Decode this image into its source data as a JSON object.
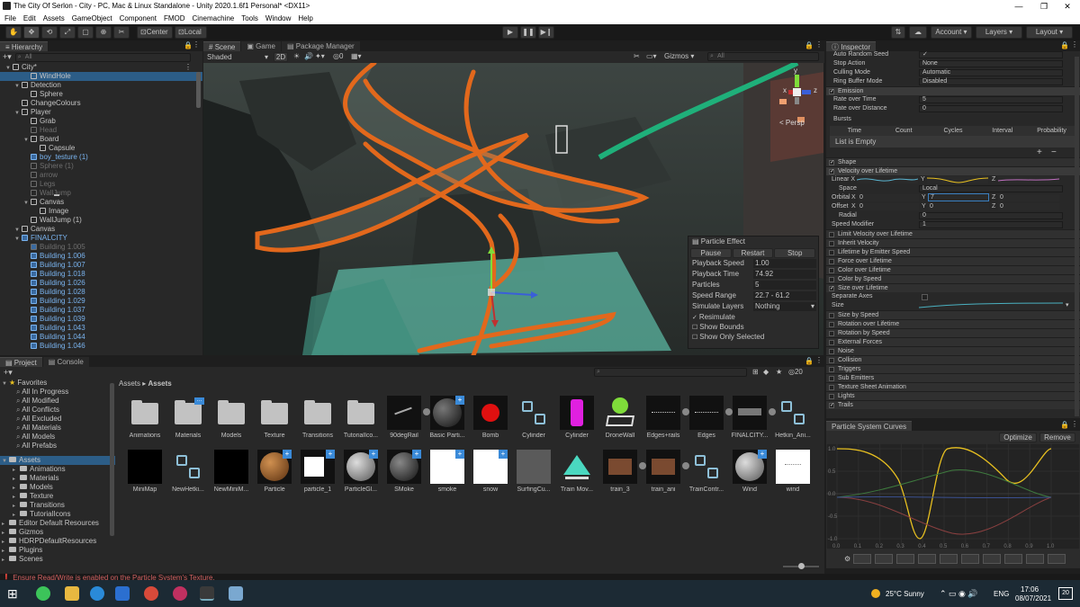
{
  "window": {
    "title": "The City Of Serlon - City - PC, Mac & Linux Standalone - Unity 2020.1.6f1 Personal* <DX11>"
  },
  "menu": [
    "File",
    "Edit",
    "Assets",
    "GameObject",
    "Component",
    "FMOD",
    "Cinemachine",
    "Tools",
    "Window",
    "Help"
  ],
  "toolbar": {
    "pivot": "Center",
    "space": "Local",
    "account": "Account",
    "layers": "Layers",
    "layout": "Layout"
  },
  "hierarchy": {
    "tab": "Hierarchy",
    "search_placeholder": "All",
    "rows": [
      {
        "label": "City*",
        "depth": 0,
        "kind": "scene",
        "sel": false
      },
      {
        "label": "WindHole",
        "depth": 2,
        "kind": "go",
        "sel": true
      },
      {
        "label": "Detection",
        "depth": 1,
        "kind": "go",
        "sel": false
      },
      {
        "label": "Sphere",
        "depth": 2,
        "kind": "go",
        "sel": false
      },
      {
        "label": "ChangeColours",
        "depth": 1,
        "kind": "go",
        "sel": false
      },
      {
        "label": "Player",
        "depth": 1,
        "kind": "go",
        "sel": false
      },
      {
        "label": "Grab",
        "depth": 2,
        "kind": "go",
        "sel": false
      },
      {
        "label": "Head",
        "depth": 2,
        "kind": "dim",
        "sel": false
      },
      {
        "label": "Board",
        "depth": 2,
        "kind": "go",
        "sel": false
      },
      {
        "label": "Capsule",
        "depth": 3,
        "kind": "go",
        "sel": false
      },
      {
        "label": "boy_testure (1)",
        "depth": 2,
        "kind": "prefab",
        "sel": false
      },
      {
        "label": "Sphere (1)",
        "depth": 2,
        "kind": "dim",
        "sel": false
      },
      {
        "label": "arrow",
        "depth": 2,
        "kind": "dim",
        "sel": false
      },
      {
        "label": "Legs",
        "depth": 2,
        "kind": "dim",
        "sel": false
      },
      {
        "label": "WallJump",
        "depth": 2,
        "kind": "dim",
        "sel": false
      },
      {
        "label": "Canvas",
        "depth": 2,
        "kind": "go",
        "sel": false
      },
      {
        "label": "Image",
        "depth": 3,
        "kind": "go",
        "sel": false
      },
      {
        "label": "WallJump (1)",
        "depth": 2,
        "kind": "go",
        "sel": false
      },
      {
        "label": "Canvas",
        "depth": 1,
        "kind": "go",
        "sel": false
      },
      {
        "label": "FINALCITY",
        "depth": 1,
        "kind": "prefab",
        "sel": false
      },
      {
        "label": "Building 1.005",
        "depth": 2,
        "kind": "dimprefab",
        "sel": false
      },
      {
        "label": "Building 1.006",
        "depth": 2,
        "kind": "prefab",
        "sel": false
      },
      {
        "label": "Building 1.007",
        "depth": 2,
        "kind": "prefab",
        "sel": false
      },
      {
        "label": "Building 1.018",
        "depth": 2,
        "kind": "prefab",
        "sel": false
      },
      {
        "label": "Building 1.026",
        "depth": 2,
        "kind": "prefab",
        "sel": false
      },
      {
        "label": "Building 1.028",
        "depth": 2,
        "kind": "prefab",
        "sel": false
      },
      {
        "label": "Building 1.029",
        "depth": 2,
        "kind": "prefab",
        "sel": false
      },
      {
        "label": "Building 1.037",
        "depth": 2,
        "kind": "prefab",
        "sel": false
      },
      {
        "label": "Building 1.039",
        "depth": 2,
        "kind": "prefab",
        "sel": false
      },
      {
        "label": "Building 1.043",
        "depth": 2,
        "kind": "prefab",
        "sel": false
      },
      {
        "label": "Building 1.044",
        "depth": 2,
        "kind": "prefab",
        "sel": false
      },
      {
        "label": "Building 1.046",
        "depth": 2,
        "kind": "prefab",
        "sel": false
      }
    ]
  },
  "scene": {
    "tabs": [
      "Scene",
      "Game",
      "Package Manager"
    ],
    "shading": "Shaded",
    "mode_2d": "2D",
    "gizmos": "Gizmos",
    "search_placeholder": "All",
    "persp": "< Persp",
    "axes": {
      "y": "y",
      "x": "x",
      "z": "z"
    },
    "overlay": {
      "title": "Particle Effect",
      "buttons": [
        "Pause",
        "Restart",
        "Stop"
      ],
      "rows": [
        {
          "label": "Playback Speed",
          "value": "1.00"
        },
        {
          "label": "Playback Time",
          "value": "74.92"
        },
        {
          "label": "Particles",
          "value": "5"
        },
        {
          "label": "Speed Range",
          "value": "22.7 - 61.2"
        },
        {
          "label": "Simulate Layers",
          "value": "Nothing"
        }
      ],
      "checks": [
        {
          "label": "Resimulate",
          "on": true
        },
        {
          "label": "Show Bounds",
          "on": false
        },
        {
          "label": "Show Only Selected",
          "on": false
        }
      ]
    }
  },
  "inspector": {
    "tab": "Inspector",
    "top_rows": [
      {
        "label": "Auto Random Seed",
        "value": "✓"
      },
      {
        "label": "Stop Action",
        "value": "None"
      },
      {
        "label": "Culling Mode",
        "value": "Automatic"
      },
      {
        "label": "Ring Buffer Mode",
        "value": "Disabled"
      }
    ],
    "emission": {
      "header": "Emission",
      "rows": [
        {
          "label": "Rate over Time",
          "value": "5"
        },
        {
          "label": "Rate over Distance",
          "value": "0"
        }
      ],
      "bursts": "Bursts",
      "burst_cols": [
        "Time",
        "Count",
        "Cycles",
        "Interval",
        "Probability"
      ],
      "empty": "List is Empty"
    },
    "shape": "Shape",
    "velocity": {
      "header": "Velocity over Lifetime",
      "linear": "Linear",
      "space_label": "Space",
      "space_value": "Local",
      "orbital_label": "Orbital",
      "orbital_x": "0",
      "orbital_y": "7",
      "orbital_z": "0",
      "offset_label": "Offset",
      "offset_x": "0",
      "offset_y": "0",
      "offset_z": "0",
      "radial_label": "Radial",
      "radial_value": "0",
      "speedmod_label": "Speed Modifier",
      "speedmod_value": "1"
    },
    "modules_a": [
      {
        "label": "Limit Velocity over Lifetime",
        "on": false
      },
      {
        "label": "Inherit Velocity",
        "on": false
      },
      {
        "label": "Lifetime by Emitter Speed",
        "on": false
      },
      {
        "label": "Force over Lifetime",
        "on": false
      },
      {
        "label": "Color over Lifetime",
        "on": false
      },
      {
        "label": "Color by Speed",
        "on": false
      },
      {
        "label": "Size over Lifetime",
        "on": true
      }
    ],
    "size": {
      "separate": "Separate Axes",
      "size": "Size"
    },
    "modules_b": [
      {
        "label": "Size by Speed",
        "on": false
      },
      {
        "label": "Rotation over Lifetime",
        "on": false
      },
      {
        "label": "Rotation by Speed",
        "on": false
      },
      {
        "label": "External Forces",
        "on": false
      },
      {
        "label": "Noise",
        "on": false
      },
      {
        "label": "Collision",
        "on": false
      },
      {
        "label": "Triggers",
        "on": false
      },
      {
        "label": "Sub Emitters",
        "on": false
      },
      {
        "label": "Texture Sheet Animation",
        "on": false
      },
      {
        "label": "Lights",
        "on": false
      },
      {
        "label": "Trails",
        "on": true
      }
    ]
  },
  "curves": {
    "title": "Particle System Curves",
    "optimize": "Optimize",
    "remove": "Remove",
    "y_ticks": [
      "1.0",
      "0.5",
      "0.0",
      "-0.5",
      "-1.0"
    ],
    "x_ticks": [
      "0.0",
      "0.1",
      "0.2",
      "0.3",
      "0.4",
      "0.5",
      "0.6",
      "0.7",
      "0.8",
      "0.9",
      "1.0"
    ],
    "colors": {
      "main": "#e8c020",
      "x": "#c04a4a",
      "y": "#4a9a4a",
      "z": "#4a6ac0"
    }
  },
  "project": {
    "tabs": [
      "Project",
      "Console"
    ],
    "favorites": "Favorites",
    "fav_items": [
      "All In Progress",
      "All Modified",
      "All Conflicts",
      "All Excluded",
      "All Materials",
      "All Models",
      "All Prefabs"
    ],
    "assets_root": "Assets",
    "tree": [
      {
        "label": "Assets",
        "depth": 0,
        "sel": true
      },
      {
        "label": "Animations",
        "depth": 1,
        "sel": false
      },
      {
        "label": "Materials",
        "depth": 1,
        "sel": false
      },
      {
        "label": "Models",
        "depth": 1,
        "sel": false
      },
      {
        "label": "Texture",
        "depth": 1,
        "sel": false
      },
      {
        "label": "Transitions",
        "depth": 1,
        "sel": false
      },
      {
        "label": "TutorialIcons",
        "depth": 1,
        "sel": false
      },
      {
        "label": "Editor Default Resources",
        "depth": 0,
        "sel": false
      },
      {
        "label": "Gizmos",
        "depth": 0,
        "sel": false
      },
      {
        "label": "HDRPDefaultResources",
        "depth": 0,
        "sel": false
      },
      {
        "label": "Plugins",
        "depth": 0,
        "sel": false
      },
      {
        "label": "Scenes",
        "depth": 0,
        "sel": false
      }
    ],
    "breadcrumb_a": "Assets",
    "breadcrumb_b": "Assets",
    "count": "20",
    "row1": [
      {
        "label": "Animations",
        "t": "folder"
      },
      {
        "label": "Materials",
        "t": "folderdots"
      },
      {
        "label": "Models",
        "t": "folder"
      },
      {
        "label": "Texture",
        "t": "folder"
      },
      {
        "label": "Transitions",
        "t": "folder"
      },
      {
        "label": "TutorialIco...",
        "t": "folder"
      },
      {
        "label": "90degRail",
        "t": "rail"
      },
      {
        "label": "Basic Parti...",
        "t": "sphereplus"
      },
      {
        "label": "Bomb",
        "t": "bomb"
      },
      {
        "label": "Cylinder",
        "t": "prefab"
      },
      {
        "label": "Cylinder",
        "t": "magenta"
      },
      {
        "label": "DroneWall",
        "t": "drone"
      },
      {
        "label": "Edges+rails",
        "t": "edges"
      },
      {
        "label": "Edges",
        "t": "edges"
      },
      {
        "label": "FINALCITY...",
        "t": "city"
      },
      {
        "label": "Hetkin_Ani...",
        "t": "prefab"
      }
    ],
    "row2": [
      {
        "label": "MiniMap",
        "t": "black"
      },
      {
        "label": "NewHetki...",
        "t": "prefab"
      },
      {
        "label": "NewMiniM...",
        "t": "black"
      },
      {
        "label": "Particle",
        "t": "particle"
      },
      {
        "label": "particle_1",
        "t": "whitesq"
      },
      {
        "label": "ParticleGl...",
        "t": "graysphere"
      },
      {
        "label": "SMoke",
        "t": "darksphere"
      },
      {
        "label": "smoke",
        "t": "white"
      },
      {
        "label": "snow",
        "t": "white"
      },
      {
        "label": "SurfingCu...",
        "t": "gray"
      },
      {
        "label": "Train Mov...",
        "t": "tri"
      },
      {
        "label": "train_3",
        "t": "train"
      },
      {
        "label": "train_ani",
        "t": "train"
      },
      {
        "label": "TrainContr...",
        "t": "prefab"
      },
      {
        "label": "Wind",
        "t": "graysphere"
      },
      {
        "label": "wind",
        "t": "dots"
      }
    ]
  },
  "status": {
    "message": "Ensure Read/Write is enabled on the Particle System's Texture."
  },
  "taskbar": {
    "weather": "25°C  Sunny",
    "lang": "ENG",
    "time": "17:06",
    "date": "08/07/2021",
    "badge": "20"
  }
}
